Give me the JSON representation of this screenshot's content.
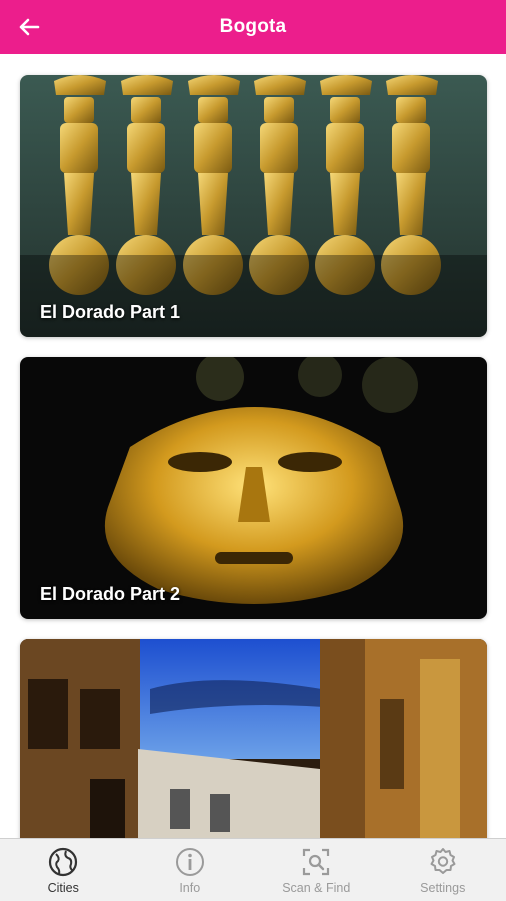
{
  "header": {
    "title": "Bogota",
    "back_icon": "arrow-left-icon",
    "background": "#ec1e8c"
  },
  "cards": [
    {
      "label": "El Dorado Part 1"
    },
    {
      "label": "El Dorado Part 2"
    },
    {
      "label": ""
    }
  ],
  "tabs": [
    {
      "label": "Cities",
      "icon": "globe-icon",
      "active": true
    },
    {
      "label": "Info",
      "icon": "info-icon",
      "active": false
    },
    {
      "label": "Scan & Find",
      "icon": "scan-icon",
      "active": false
    },
    {
      "label": "Settings",
      "icon": "gear-icon",
      "active": false
    }
  ]
}
